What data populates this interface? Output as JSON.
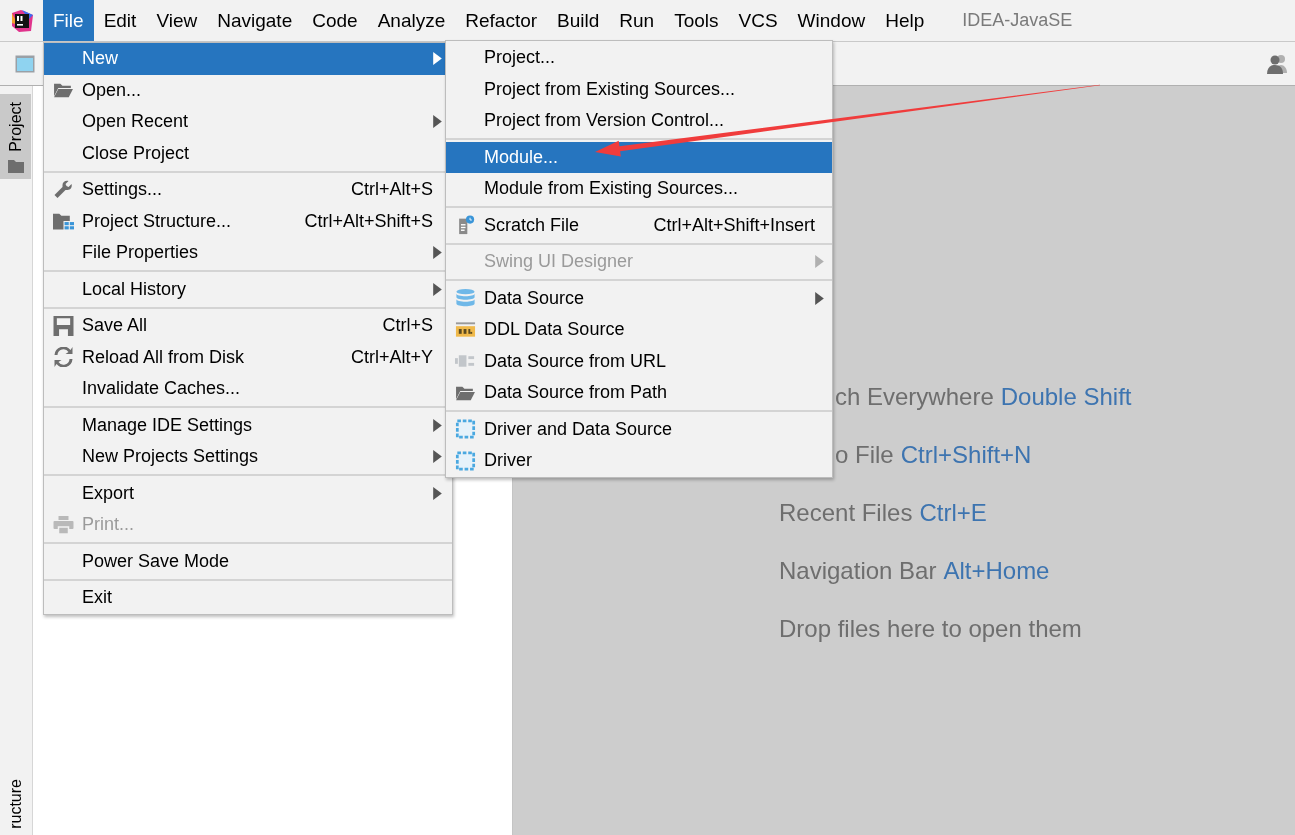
{
  "menubar": {
    "items": [
      {
        "label": "File",
        "selected": true
      },
      {
        "label": "Edit",
        "selected": false
      },
      {
        "label": "View",
        "selected": false
      },
      {
        "label": "Navigate",
        "selected": false
      },
      {
        "label": "Code",
        "selected": false
      },
      {
        "label": "Analyze",
        "selected": false
      },
      {
        "label": "Refactor",
        "selected": false
      },
      {
        "label": "Build",
        "selected": false
      },
      {
        "label": "Run",
        "selected": false
      },
      {
        "label": "Tools",
        "selected": false
      },
      {
        "label": "VCS",
        "selected": false
      },
      {
        "label": "Window",
        "selected": false
      },
      {
        "label": "Help",
        "selected": false
      }
    ],
    "title": "IDEA-JavaSE"
  },
  "tool_strip": {
    "tabs": [
      {
        "label": "Project",
        "selected": true
      },
      {
        "label": "ructure",
        "selected": false
      }
    ]
  },
  "file_menu": {
    "groups": [
      [
        {
          "label": "New",
          "submenu": true,
          "disabled": false,
          "selected": true
        },
        {
          "label": "Open...",
          "submenu": false,
          "disabled": false,
          "selected": false
        },
        {
          "label": "Open Recent",
          "submenu": true,
          "disabled": false,
          "selected": false
        },
        {
          "label": "Close Project",
          "submenu": false,
          "disabled": false,
          "selected": false
        }
      ],
      [
        {
          "label": "Settings...",
          "shortcut": "Ctrl+Alt+S",
          "submenu": false,
          "disabled": false,
          "selected": false
        },
        {
          "label": "Project Structure...",
          "shortcut": "Ctrl+Alt+Shift+S",
          "submenu": false,
          "disabled": false,
          "selected": false
        },
        {
          "label": "File Properties",
          "submenu": true,
          "disabled": false,
          "selected": false
        }
      ],
      [
        {
          "label": "Local History",
          "submenu": true,
          "disabled": false,
          "selected": false
        }
      ],
      [
        {
          "label": "Save All",
          "shortcut": "Ctrl+S",
          "submenu": false,
          "disabled": false,
          "selected": false
        },
        {
          "label": "Reload All from Disk",
          "shortcut": "Ctrl+Alt+Y",
          "submenu": false,
          "disabled": false,
          "selected": false
        },
        {
          "label": "Invalidate Caches...",
          "submenu": false,
          "disabled": false,
          "selected": false
        }
      ],
      [
        {
          "label": "Manage IDE Settings",
          "submenu": true,
          "disabled": false,
          "selected": false
        },
        {
          "label": "New Projects Settings",
          "submenu": true,
          "disabled": false,
          "selected": false
        }
      ],
      [
        {
          "label": "Export",
          "submenu": true,
          "disabled": false,
          "selected": false
        },
        {
          "label": "Print...",
          "submenu": false,
          "disabled": true,
          "selected": false
        }
      ],
      [
        {
          "label": "Power Save Mode",
          "submenu": false,
          "disabled": false,
          "selected": false
        }
      ],
      [
        {
          "label": "Exit",
          "submenu": false,
          "disabled": false,
          "selected": false
        }
      ]
    ]
  },
  "new_submenu": {
    "groups": [
      [
        {
          "label": "Project...",
          "submenu": false,
          "disabled": false,
          "selected": false
        },
        {
          "label": "Project from Existing Sources...",
          "submenu": false,
          "disabled": false,
          "selected": false
        },
        {
          "label": "Project from Version Control...",
          "submenu": false,
          "disabled": false,
          "selected": false
        }
      ],
      [
        {
          "label": "Module...",
          "submenu": false,
          "disabled": false,
          "selected": true
        },
        {
          "label": "Module from Existing Sources...",
          "submenu": false,
          "disabled": false,
          "selected": false
        }
      ],
      [
        {
          "label": "Scratch File",
          "shortcut": "Ctrl+Alt+Shift+Insert",
          "submenu": false,
          "disabled": false,
          "selected": false
        }
      ],
      [
        {
          "label": "Swing UI Designer",
          "submenu": true,
          "disabled": true,
          "selected": false
        }
      ],
      [
        {
          "label": "Data Source",
          "submenu": true,
          "disabled": false,
          "selected": false
        },
        {
          "label": "DDL Data Source",
          "submenu": false,
          "disabled": false,
          "selected": false
        },
        {
          "label": "Data Source from URL",
          "submenu": false,
          "disabled": false,
          "selected": false
        },
        {
          "label": "Data Source from Path",
          "submenu": false,
          "disabled": false,
          "selected": false
        }
      ],
      [
        {
          "label": "Driver and Data Source",
          "submenu": false,
          "disabled": false,
          "selected": false
        },
        {
          "label": "Driver",
          "submenu": false,
          "disabled": false,
          "selected": false
        }
      ]
    ]
  },
  "editor_hints": [
    {
      "text": "ch Everywhere",
      "shortcut": "Double Shift",
      "partly_hidden": true
    },
    {
      "text": "o File",
      "shortcut": "Ctrl+Shift+N",
      "partly_hidden": true
    },
    {
      "text": "Recent Files",
      "shortcut": "Ctrl+E"
    },
    {
      "text": "Navigation Bar",
      "shortcut": "Alt+Home"
    },
    {
      "text": "Drop files here to open them"
    }
  ]
}
